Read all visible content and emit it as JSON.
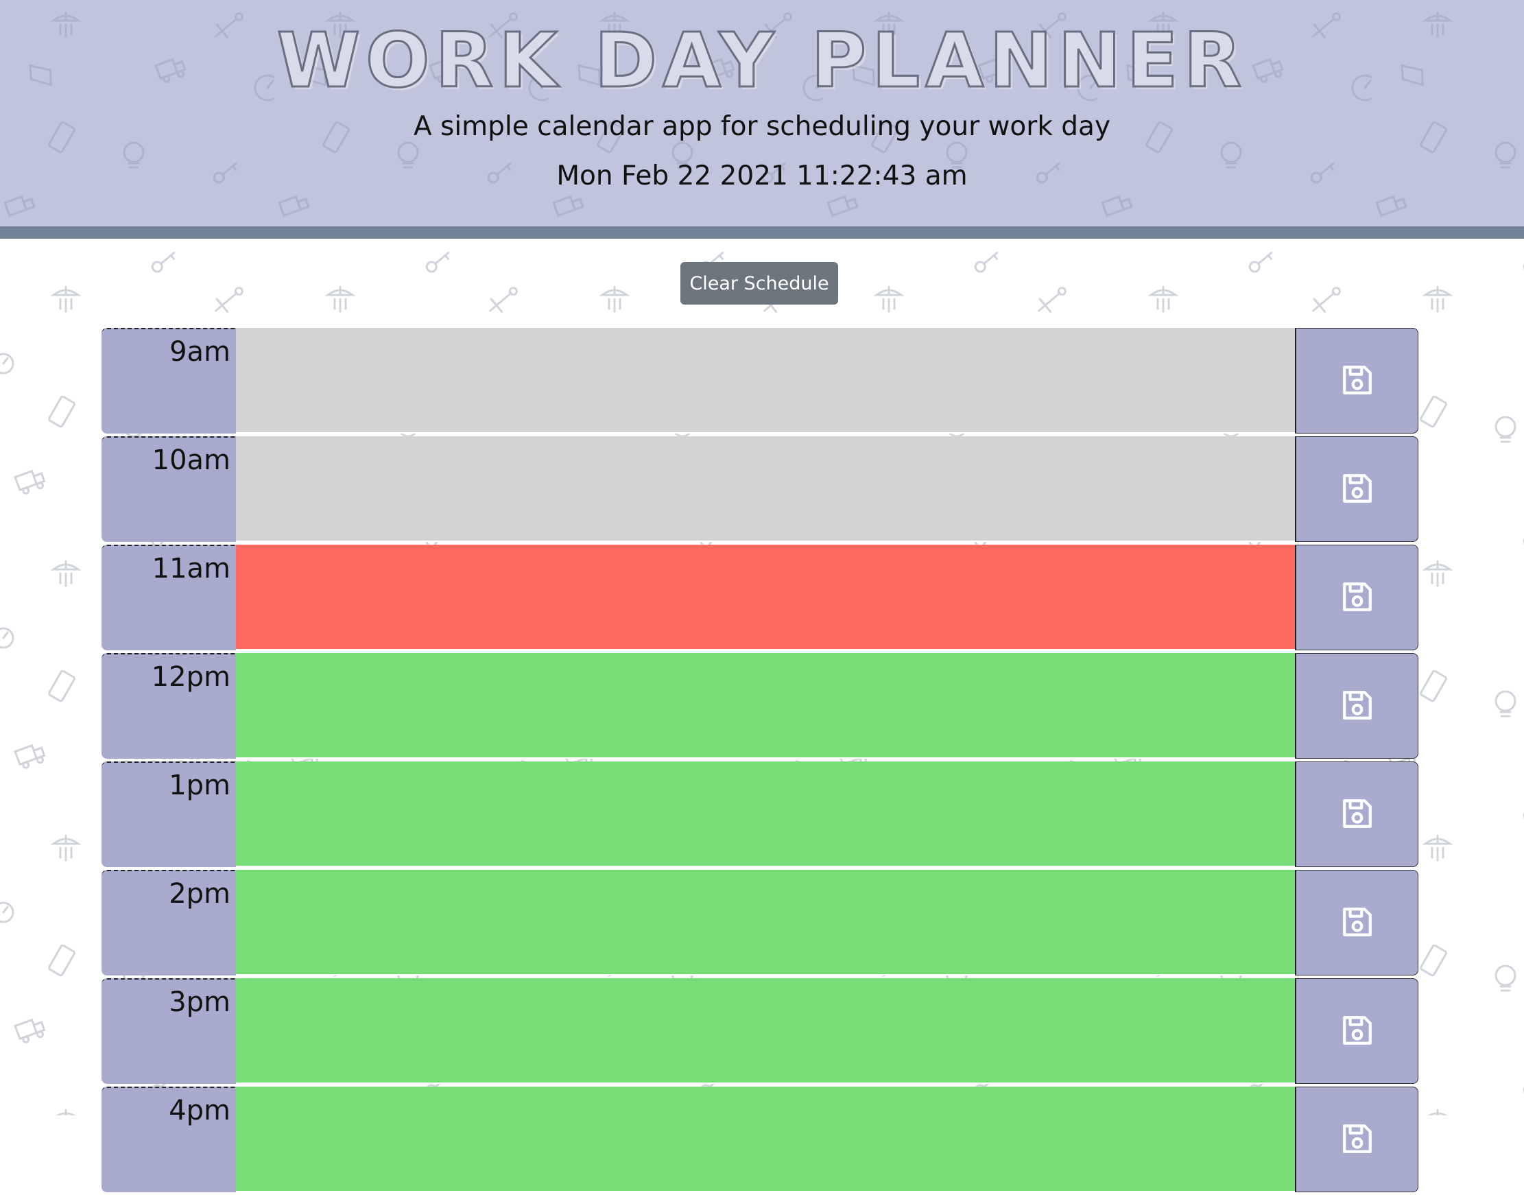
{
  "header": {
    "title": "WORK DAY PLANNER",
    "lead": "A simple calendar app for scheduling your work day",
    "current_day": "Mon Feb 22 2021 11:22:43 am"
  },
  "controls": {
    "clear_label": "Clear Schedule"
  },
  "colors": {
    "jumbotron": "#c0c4dc",
    "jumbotron_border": "#738195",
    "hour_block": "#a8aace",
    "past": "#d3d3d3",
    "present": "#ff6961",
    "future": "#77dd77",
    "button": "#6c757d"
  },
  "schedule": {
    "rows": [
      {
        "hour": "9am",
        "status": "past",
        "text": "",
        "save_icon": "floppy-disk-icon"
      },
      {
        "hour": "10am",
        "status": "past",
        "text": "",
        "save_icon": "floppy-disk-icon"
      },
      {
        "hour": "11am",
        "status": "present",
        "text": "",
        "save_icon": "floppy-disk-icon"
      },
      {
        "hour": "12pm",
        "status": "future",
        "text": "",
        "save_icon": "floppy-disk-icon"
      },
      {
        "hour": "1pm",
        "status": "future",
        "text": "",
        "save_icon": "floppy-disk-icon"
      },
      {
        "hour": "2pm",
        "status": "future",
        "text": "",
        "save_icon": "floppy-disk-icon"
      },
      {
        "hour": "3pm",
        "status": "future",
        "text": "",
        "save_icon": "floppy-disk-icon"
      },
      {
        "hour": "4pm",
        "status": "future",
        "text": "",
        "save_icon": "floppy-disk-icon"
      }
    ]
  },
  "background_icons": [
    "shower-icon",
    "tools-icon",
    "paint-roller-icon",
    "lightbulb-icon",
    "key-icon",
    "phone-icon",
    "gauge-icon",
    "truck-icon",
    "paint-brush-icon"
  ]
}
